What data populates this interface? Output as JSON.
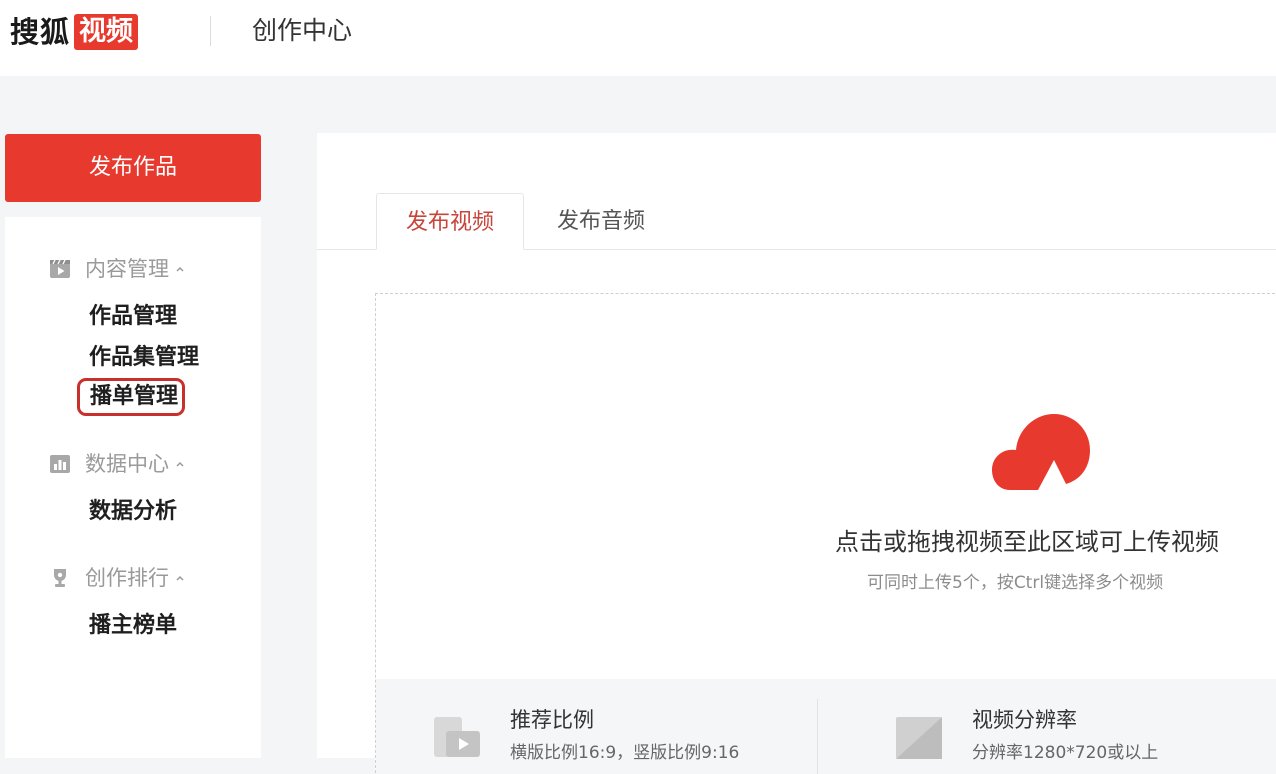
{
  "header": {
    "logo_text": "搜狐",
    "logo_badge": "视频",
    "title": "创作中心"
  },
  "sidebar": {
    "publish_button": "发布作品",
    "groups": [
      {
        "label": "内容管理",
        "icon": "video-icon",
        "expanded": true,
        "items": [
          "作品管理",
          "作品集管理",
          "播单管理"
        ]
      },
      {
        "label": "数据中心",
        "icon": "bar-chart-icon",
        "expanded": true,
        "items": [
          "数据分析"
        ]
      },
      {
        "label": "创作排行",
        "icon": "trophy-icon",
        "expanded": true,
        "items": [
          "播主榜单"
        ]
      }
    ],
    "highlighted_item": "播单管理"
  },
  "main": {
    "tabs": [
      {
        "label": "发布视频",
        "active": true
      },
      {
        "label": "发布音频",
        "active": false
      }
    ],
    "upload": {
      "icon": "cloud-upload-icon",
      "main_text": "点击或拖拽视频至此区域可上传视频",
      "sub_text": "可同时上传5个，按Ctrl键选择多个视频"
    },
    "specs": [
      {
        "icon": "aspect-ratio-icon",
        "title": "推荐比例",
        "desc": "横版比例16:9，竖版比例9:16"
      },
      {
        "icon": "resolution-icon",
        "title": "视频分辨率",
        "desc": "分辨率1280*720或以上"
      }
    ]
  },
  "colors": {
    "brand_red": "#e8392e",
    "active_tab_text": "#c7453a",
    "highlight_border": "#c9302c",
    "page_bg": "#f4f5f7"
  }
}
